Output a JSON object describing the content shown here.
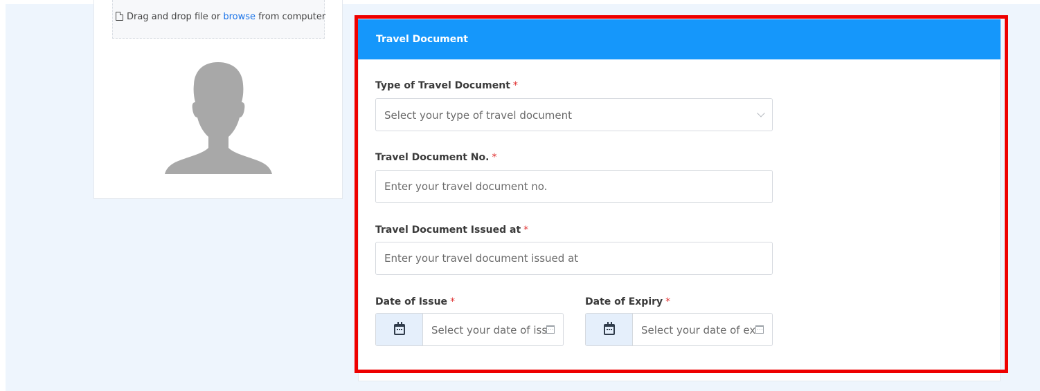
{
  "upload": {
    "prefix_text": "Drag and drop file or",
    "browse_label": "browse",
    "suffix_text": "from computer"
  },
  "travel_document": {
    "section_title": "Travel Document",
    "required_marker": "*",
    "type": {
      "label": "Type of Travel Document",
      "placeholder": "Select your type of travel document"
    },
    "number": {
      "label": "Travel Document No.",
      "placeholder": "Enter your travel document no."
    },
    "issued_at": {
      "label": "Travel Document Issued at",
      "placeholder": "Enter your travel document issued at"
    },
    "date_of_issue": {
      "label": "Date of Issue",
      "placeholder": "Select your date of iss"
    },
    "date_of_expiry": {
      "label": "Date of Expiry",
      "placeholder": "Select your date of ex"
    }
  },
  "colors": {
    "header_bg": "#1597fb",
    "highlight_border": "#ee0000",
    "link": "#1a73e8",
    "required": "#e03030",
    "page_bg": "#eef5fd"
  },
  "icons": [
    "file-icon",
    "avatar-placeholder-icon",
    "chevron-down-icon",
    "calendar-icon"
  ]
}
